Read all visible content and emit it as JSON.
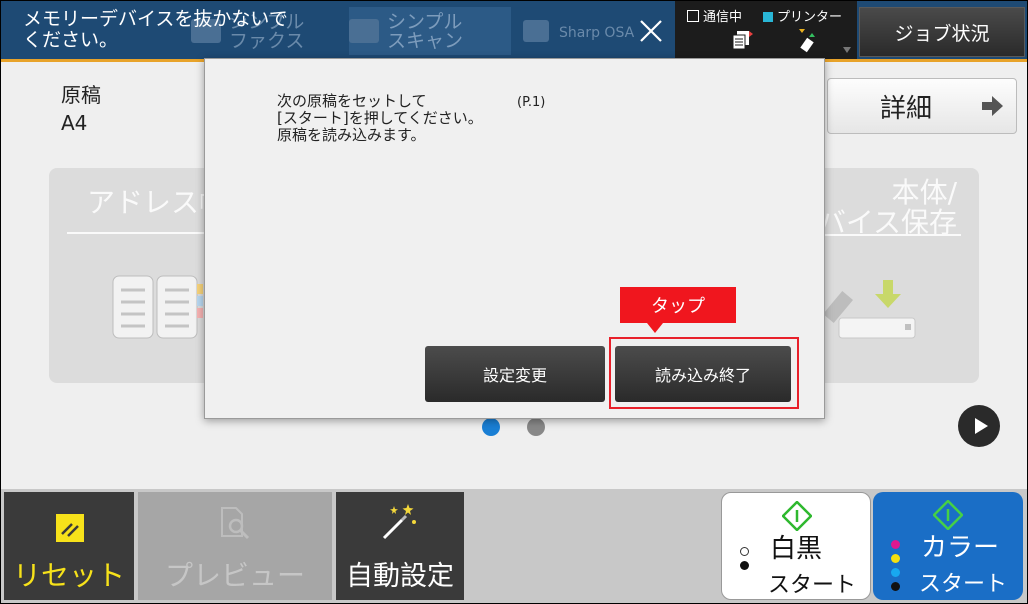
{
  "topbar": {
    "message": "メモリーデバイスを抜かないで\nください。",
    "tabs": [
      {
        "label": "シンプル\nファクス"
      },
      {
        "label": "シンプル\nスキャン"
      },
      {
        "label": "Sharp OSA"
      }
    ],
    "status": {
      "comm_label": "通信中",
      "printer_label": "プリンター"
    },
    "job_button_label": "ジョブ状況"
  },
  "original": {
    "label": "原稿",
    "value": "A4"
  },
  "detail_button_label": "詳細",
  "cards": {
    "left_title": "アドレス帳",
    "right_title": "本体/\nデバイス保存"
  },
  "dialog": {
    "message": "次の原稿をセットして\n[スタート]を押してください。\n原稿を読み込みます。",
    "page_indicator": "(P.1)",
    "settings_button": "設定変更",
    "finish_button": "読み込み終了",
    "tap_callout": "タップ"
  },
  "bottombar": {
    "reset_label": "リセット",
    "preview_label": "プレビュー",
    "auto_label": "自動設定",
    "bw_start": {
      "main": "白黒",
      "sub": "スタート"
    },
    "color_start": {
      "main": "カラー",
      "sub": "スタート"
    }
  },
  "colors": {
    "topbar_bg": "#1e4a74",
    "highlight_red": "#e8202a",
    "reset_yellow": "#f7e21a",
    "color_start_blue": "#1a6ec6",
    "pager_active": "#1a7fd4"
  }
}
